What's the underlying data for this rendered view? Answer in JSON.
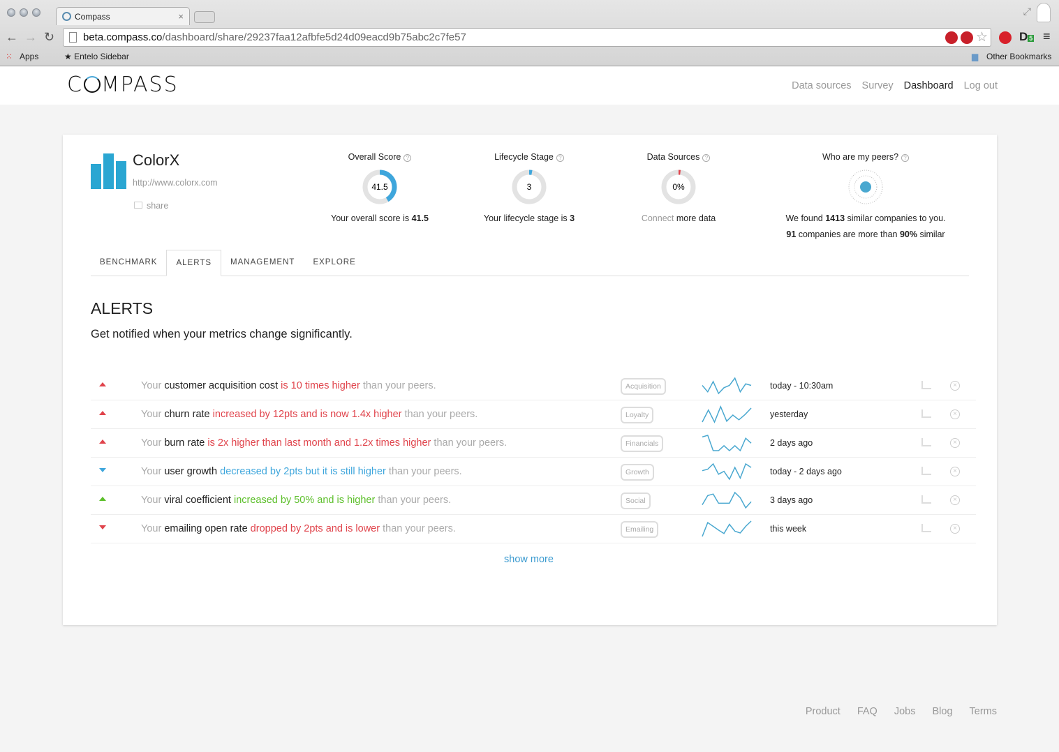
{
  "browser": {
    "tab_title": "Compass",
    "url_host": "beta.compass.co",
    "url_path": "/dashboard/share/29237faa12afbfe5d24d09eacd9b75abc2c7fe57",
    "bookmarks": [
      "Apps",
      "★ Entelo Sidebar"
    ],
    "other_bookmarks": "Other Bookmarks",
    "ext_badge": "5"
  },
  "header": {
    "logo": "COMPASS",
    "nav": [
      {
        "label": "Data sources"
      },
      {
        "label": "Survey"
      },
      {
        "label": "Dashboard",
        "active": true
      },
      {
        "label": "Log out"
      }
    ]
  },
  "company": {
    "name": "ColorX",
    "url": "http://www.colorx.com",
    "share": "share"
  },
  "stats": {
    "overall": {
      "title": "Overall Score",
      "value": "41.5",
      "fraction": 0.415,
      "cap_pre": "Your overall score is ",
      "cap_bold": "41.5"
    },
    "lifecycle": {
      "title": "Lifecycle Stage",
      "value": "3",
      "fraction": 0.03,
      "cap_pre": "Your lifecycle stage is ",
      "cap_bold": "3"
    },
    "sources": {
      "title": "Data Sources",
      "value": "0%",
      "fraction": 0.02,
      "cap_link": "Connect",
      "cap_rest": " more data"
    },
    "peers": {
      "title": "Who are my peers?",
      "l1_pre": "We found ",
      "l1_bold": "1413",
      "l1_post": " similar companies to you.",
      "l2_bold1": "91",
      "l2_mid": " companies are more than ",
      "l2_bold2": "90%",
      "l2_post": " similar"
    }
  },
  "tabs": [
    {
      "label": "BENCHMARK"
    },
    {
      "label": "ALERTS",
      "active": true
    },
    {
      "label": "MANAGEMENT"
    },
    {
      "label": "EXPLORE"
    }
  ],
  "alerts_section": {
    "title": "ALERTS",
    "subtitle": "Get notified when your metrics change significantly.",
    "show_more": "show more"
  },
  "colors": {
    "red": "#e0434b",
    "blue": "#3ea6dc",
    "green": "#5cbf2a",
    "gray": "#aaa",
    "spark": "#4aa8d0"
  },
  "alerts": [
    {
      "dir": "up",
      "color": "red",
      "metric": "customer acquisition cost",
      "change": "is 10 times higher",
      "tag": "Acquisition",
      "time": "today - 10:30am",
      "spark": [
        35,
        15,
        47,
        10,
        28,
        35,
        58,
        15,
        40,
        35
      ]
    },
    {
      "dir": "up",
      "color": "red",
      "metric": "churn rate",
      "change": "increased by 12pts and is now 1.4x higher",
      "tag": "Loyalty",
      "time": "yesterday",
      "spark": [
        5,
        48,
        5,
        60,
        8,
        30,
        13,
        32,
        55
      ]
    },
    {
      "dir": "up",
      "color": "red",
      "metric": "burn rate",
      "change": "is 2x higher than last month and 1.2x times higher",
      "tag": "Financials",
      "time": "2 days ago",
      "spark": [
        38,
        42,
        5,
        5,
        17,
        5,
        17,
        5,
        35,
        23
      ]
    },
    {
      "dir": "down",
      "color": "blue",
      "metric": "user growth",
      "change": "decreased by 2pts but it is still higher",
      "tag": "Growth",
      "time": "today - 2 days ago",
      "spark": [
        32,
        37,
        55,
        20,
        30,
        3,
        43,
        7,
        55,
        43
      ]
    },
    {
      "dir": "up",
      "color": "green",
      "metric": "viral coefficient",
      "change": "increased by 50% and is higher",
      "tag": "Social",
      "time": "3 days ago",
      "spark": [
        15,
        45,
        50,
        20,
        20,
        20,
        55,
        38,
        5,
        25
      ]
    },
    {
      "dir": "down",
      "color": "red",
      "metric": "emailing open rate",
      "change": "dropped by 2pts and is lower",
      "tag": "Emailing",
      "time": "this week",
      "spark": [
        5,
        53,
        40,
        27,
        15,
        47,
        23,
        17,
        40,
        58
      ]
    }
  ],
  "alert_text": {
    "prefix": "Your ",
    "suffix": " than your peers."
  },
  "footer": [
    {
      "label": "Product"
    },
    {
      "label": "FAQ"
    },
    {
      "label": "Jobs"
    },
    {
      "label": "Blog"
    },
    {
      "label": "Terms"
    }
  ]
}
